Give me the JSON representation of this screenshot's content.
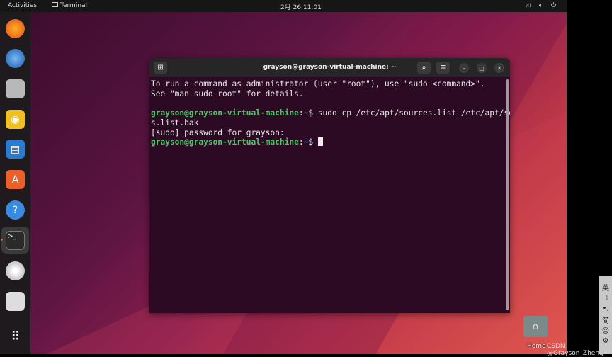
{
  "topbar": {
    "activities": "Activities",
    "app": "Terminal",
    "clock": "2月 26  11:01"
  },
  "dock": {
    "items": [
      "Firefox",
      "Thunderbird",
      "Files",
      "Rhythmbox",
      "LibreOffice Writer",
      "Ubuntu Software",
      "Help",
      "Terminal",
      "Disc",
      "Disk",
      "Show Applications"
    ]
  },
  "terminal": {
    "title": "grayson@grayson-virtual-machine: ~",
    "lines": {
      "l1": "To run a command as administrator (user \"root\"), use \"sudo <command>\".",
      "l2": "See \"man sudo_root\" for details.",
      "prompt": "grayson@grayson-virtual-machine",
      "sep": ":",
      "tilde": "~",
      "dollar": "$ ",
      "cmd": "sudo cp /etc/apt/sources.list /etc/apt/source",
      "cmd2": "s.list.bak",
      "sudo": "[sudo] password for grayson:"
    }
  },
  "desktop": {
    "home_label": "Home",
    "watermark": "CSDN @Grayson_Zheng"
  },
  "ime": {
    "items": [
      "英",
      "☽",
      "•,",
      "简",
      "☺",
      "⚙"
    ]
  }
}
